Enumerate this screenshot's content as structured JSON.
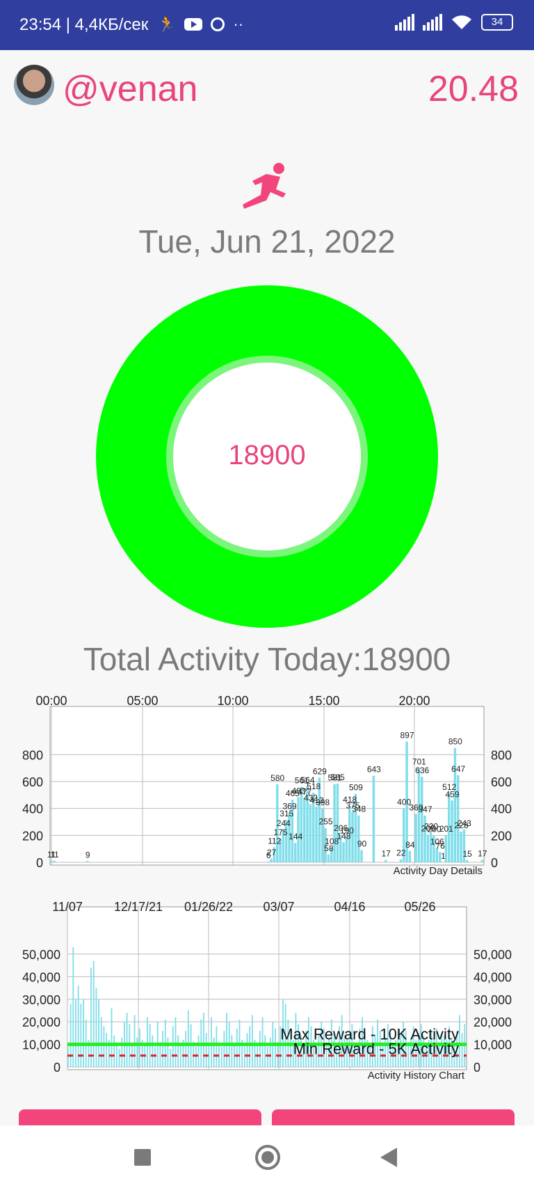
{
  "status_bar": {
    "time_speed": "23:54 | 4,4КБ/сек",
    "battery": "34"
  },
  "profile": {
    "username": "@venan",
    "score": "20.48"
  },
  "date": "Tue, Jun 21, 2022",
  "ring": {
    "value": "18900",
    "progress": 1.0,
    "color": "#00ff00"
  },
  "total_activity": "Total Activity Today:18900",
  "accent_color": "#e8457a",
  "chart_data": [
    {
      "type": "bar",
      "name_label": "Activity Day Details",
      "x_ticks": [
        "00:00",
        "05:00",
        "10:00",
        "15:00",
        "20:00"
      ],
      "y_ticks": [
        "0",
        "200",
        "400",
        "600",
        "800"
      ],
      "ylim": [
        0,
        900
      ],
      "bar_color": "#80deea",
      "values": [
        11,
        11,
        0,
        0,
        0,
        0,
        0,
        0,
        0,
        0,
        0,
        0,
        9,
        0,
        0,
        0,
        0,
        0,
        0,
        0,
        0,
        0,
        0,
        0,
        0,
        0,
        0,
        0,
        0,
        0,
        0,
        0,
        0,
        0,
        0,
        0,
        0,
        0,
        0,
        0,
        0,
        0,
        0,
        0,
        0,
        0,
        0,
        0,
        0,
        0,
        0,
        0,
        0,
        0,
        0,
        0,
        0,
        0,
        0,
        0,
        0,
        0,
        0,
        0,
        0,
        0,
        0,
        0,
        0,
        0,
        0,
        0,
        6,
        27,
        112,
        580,
        175,
        244,
        315,
        369,
        465,
        144,
        483,
        561,
        477,
        564,
        432,
        518,
        413,
        629,
        398,
        255,
        58,
        108,
        581,
        585,
        206,
        148,
        190,
        418,
        375,
        509,
        348,
        90,
        0,
        0,
        0,
        643,
        0,
        0,
        0,
        17,
        0,
        0,
        0,
        0,
        22,
        400,
        897,
        84,
        0,
        360,
        701,
        636,
        347,
        205,
        220,
        200,
        106,
        76,
        1,
        201,
        512,
        459,
        850,
        647,
        228,
        243,
        15,
        0,
        0,
        0,
        0,
        17
      ],
      "labels": [
        {
          "i": 0,
          "v": "11"
        },
        {
          "i": 1,
          "v": "11"
        },
        {
          "i": 12,
          "v": "9"
        },
        {
          "i": 72,
          "v": "6"
        },
        {
          "i": 73,
          "v": "27"
        },
        {
          "i": 74,
          "v": "112"
        },
        {
          "i": 75,
          "v": "580"
        },
        {
          "i": 76,
          "v": "175"
        },
        {
          "i": 77,
          "v": "244"
        },
        {
          "i": 78,
          "v": "315"
        },
        {
          "i": 79,
          "v": "369"
        },
        {
          "i": 80,
          "v": "465"
        },
        {
          "i": 81,
          "v": "144"
        },
        {
          "i": 82,
          "v": "483"
        },
        {
          "i": 83,
          "v": "561"
        },
        {
          "i": 84,
          "v": "477"
        },
        {
          "i": 85,
          "v": "564"
        },
        {
          "i": 86,
          "v": "432"
        },
        {
          "i": 87,
          "v": "518"
        },
        {
          "i": 88,
          "v": "413"
        },
        {
          "i": 89,
          "v": "629"
        },
        {
          "i": 90,
          "v": "398"
        },
        {
          "i": 91,
          "v": "255"
        },
        {
          "i": 92,
          "v": "58"
        },
        {
          "i": 93,
          "v": "108"
        },
        {
          "i": 94,
          "v": "581"
        },
        {
          "i": 95,
          "v": "585"
        },
        {
          "i": 96,
          "v": "206"
        },
        {
          "i": 97,
          "v": "148"
        },
        {
          "i": 98,
          "v": "190"
        },
        {
          "i": 99,
          "v": "418"
        },
        {
          "i": 100,
          "v": "375"
        },
        {
          "i": 101,
          "v": "509"
        },
        {
          "i": 102,
          "v": "348"
        },
        {
          "i": 103,
          "v": "90"
        },
        {
          "i": 107,
          "v": "643"
        },
        {
          "i": 111,
          "v": "17"
        },
        {
          "i": 116,
          "v": "22"
        },
        {
          "i": 117,
          "v": "400"
        },
        {
          "i": 118,
          "v": "897"
        },
        {
          "i": 119,
          "v": "84"
        },
        {
          "i": 121,
          "v": "360"
        },
        {
          "i": 122,
          "v": "701"
        },
        {
          "i": 123,
          "v": "636"
        },
        {
          "i": 124,
          "v": "347"
        },
        {
          "i": 125,
          "v": "205"
        },
        {
          "i": 126,
          "v": "220"
        },
        {
          "i": 127,
          "v": "200"
        },
        {
          "i": 128,
          "v": "106"
        },
        {
          "i": 129,
          "v": "76"
        },
        {
          "i": 130,
          "v": "1"
        },
        {
          "i": 131,
          "v": "201"
        },
        {
          "i": 132,
          "v": "512"
        },
        {
          "i": 133,
          "v": "459"
        },
        {
          "i": 134,
          "v": "850"
        },
        {
          "i": 135,
          "v": "647"
        },
        {
          "i": 136,
          "v": "228"
        },
        {
          "i": 137,
          "v": "243"
        },
        {
          "i": 138,
          "v": "15"
        },
        {
          "i": 143,
          "v": "17"
        }
      ]
    },
    {
      "type": "bar",
      "name_label": "Activity History Chart",
      "x_ticks": [
        "11/07",
        "12/17/21",
        "01/26/22",
        "03/07",
        "04/16",
        "05/26"
      ],
      "y_ticks": [
        "0",
        "10,000",
        "20,000",
        "30,000",
        "40,000",
        "50,000"
      ],
      "ylim": [
        0,
        58000
      ],
      "bar_color": "#80deea",
      "values": [
        9000,
        28000,
        53000,
        30000,
        36000,
        28000,
        30000,
        21000,
        12000,
        44000,
        47000,
        35000,
        30000,
        22000,
        18000,
        15000,
        12000,
        26000,
        14000,
        11000,
        8000,
        13000,
        20000,
        24000,
        19000,
        10000,
        23000,
        13000,
        17000,
        12000,
        10000,
        22000,
        19000,
        14000,
        9000,
        20000,
        11000,
        16000,
        21000,
        13000,
        8000,
        18000,
        22000,
        14000,
        10000,
        12000,
        16000,
        25000,
        19000,
        11000,
        9000,
        14000,
        21000,
        24000,
        15000,
        10000,
        22000,
        13000,
        18000,
        11000,
        9000,
        16000,
        24000,
        20000,
        14000,
        10000,
        17000,
        21000,
        12000,
        9000,
        15000,
        18000,
        23000,
        12000,
        10000,
        16000,
        22000,
        14000,
        9000,
        13000,
        20000,
        17000,
        11000,
        18000,
        30000,
        28000,
        21000,
        15000,
        12000,
        24000,
        19000,
        14000,
        10000,
        16000,
        22000,
        18000,
        12000,
        9000,
        14000,
        20000,
        17000,
        11000,
        13000,
        21000,
        15000,
        10000,
        18000,
        23000,
        14000,
        12000,
        16000,
        19000,
        11000,
        9000,
        17000,
        22000,
        15000,
        12000,
        10000,
        18000,
        14000,
        21000,
        16000,
        11000,
        13000,
        19000,
        15000,
        10000,
        12000,
        17000,
        14000,
        20000,
        16000,
        11000,
        13000,
        18000,
        12000,
        15000,
        19000,
        14000,
        10000,
        12000,
        16000,
        13000,
        17000,
        11000,
        15000,
        14000,
        12000,
        18000,
        13000,
        10000,
        16000,
        23000,
        15000,
        19000
      ],
      "max_reward": {
        "label": "Max Reward - 10K Activity",
        "value": 10000,
        "color": "#22ee22"
      },
      "min_reward": {
        "label": "Min Reward - 5K Activity",
        "value": 5000,
        "color": "#dd2222"
      }
    }
  ],
  "navbar": {
    "square": "square-icon",
    "home": "circle-icon",
    "back": "triangle-back-icon"
  }
}
